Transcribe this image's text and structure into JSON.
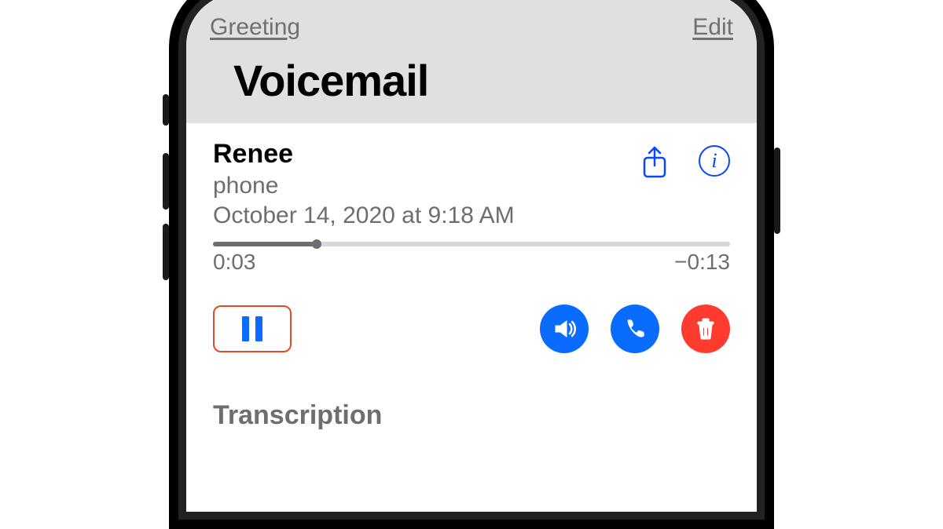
{
  "nav": {
    "greeting": "Greeting",
    "edit": "Edit"
  },
  "title": "Voicemail",
  "voicemail": {
    "caller": "Renee",
    "source": "phone",
    "timestamp": "October 14, 2020 at 9:18 AM",
    "elapsed": "0:03",
    "remaining": "−0:13",
    "progress_percent": 20
  },
  "transcription_heading": "Transcription",
  "colors": {
    "accent_blue": "#0a6bff",
    "action_blue": "#0a46ff",
    "danger_red": "#ff3b30",
    "muted_gray": "#6d6d72",
    "highlight_border": "#e4492a"
  }
}
